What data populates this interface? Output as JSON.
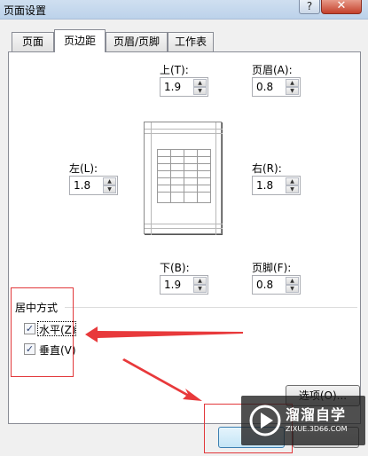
{
  "title": "页面设置",
  "title_buttons": {
    "help": "?",
    "close": "✕"
  },
  "tabs": [
    {
      "label": "页面",
      "active": false
    },
    {
      "label": "页边距",
      "active": true
    },
    {
      "label": "页眉/页脚",
      "active": false
    },
    {
      "label": "工作表",
      "active": false
    }
  ],
  "margins": {
    "top": {
      "label": "上(T):",
      "value": "1.9"
    },
    "header": {
      "label": "页眉(A):",
      "value": "0.8"
    },
    "left": {
      "label": "左(L):",
      "value": "1.8"
    },
    "right": {
      "label": "右(R):",
      "value": "1.8"
    },
    "bottom": {
      "label": "下(B):",
      "value": "1.9"
    },
    "footer": {
      "label": "页脚(F):",
      "value": "0.8"
    }
  },
  "centering": {
    "group_label": "居中方式",
    "horizontal": {
      "label": "水平(Z)",
      "checked": true
    },
    "vertical": {
      "label": "垂直(V)",
      "checked": true
    }
  },
  "options_button": "选项(O)...",
  "watermark": {
    "brand": "溜溜自学",
    "url": "ZIXUE.3D66.COM"
  },
  "colors": {
    "annotation_red": "#e2383b",
    "arrow_red": "#e8393b"
  }
}
